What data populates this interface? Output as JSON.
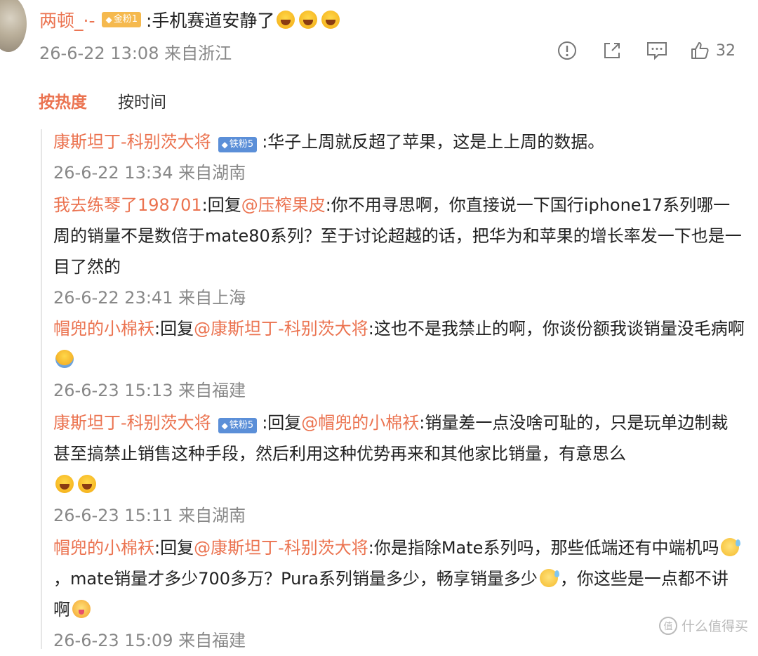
{
  "comment": {
    "username": "两顿_·-",
    "badge": "金粉1",
    "text": ":手机赛道安静了",
    "emojis": [
      "laugh",
      "laugh",
      "laugh"
    ],
    "time": "26-6-22 13:08",
    "location": "来自浙江",
    "likes": "32"
  },
  "sort": {
    "hot": "按热度",
    "time": "按时间"
  },
  "replies": [
    {
      "user": "康斯坦丁-科别茨大将",
      "badge": "铁粉5",
      "text": ":华子上周就反超了苹果，这是上上周的数据。",
      "time": "26-6-22 13:34",
      "location": "来自湖南"
    },
    {
      "user": "我去练琴了198701",
      "reply_label": ":回复",
      "mention": "@压榨果皮",
      "text": ":你不用寻思啊，你直接说一下国行iphone17系列哪一周的销量不是数倍于mate80系列？至于讨论超越的话，把华为和苹果的增长率发一下也是一目了然的",
      "time": "26-6-22 23:41",
      "location": "来自上海"
    },
    {
      "user": "帽兜的小棉袄",
      "reply_label": ":回复",
      "mention": "@康斯坦丁-科别茨大将",
      "text": ":这也不是我禁止的啊，你谈份额我谈销量没毛病啊",
      "time": "26-6-23 15:13",
      "location": "来自福建"
    },
    {
      "user": "康斯坦丁-科别茨大将",
      "badge": "铁粉5",
      "reply_label": ":回复",
      "mention": "@帽兜的小棉袄",
      "text": ":销量差一点没啥可耻的，只是玩单边制裁甚至搞禁止销售这种手段，然后利用这种优势再来和其他家比销量，有意思么",
      "time": "26-6-23 15:11",
      "location": "来自湖南"
    },
    {
      "user": "帽兜的小棉袄",
      "reply_label": ":回复",
      "mention": "@康斯坦丁-科别茨大将",
      "text_a": ":你是指除Mate系列吗，那些低端还有中端机吗",
      "text_b": "，mate销量才多少700多万？Pura系列销量多少，畅享销量多少",
      "text_c": "，你这些是一点都不讲啊",
      "time": "26-6-23 15:09",
      "location": "来自福建"
    }
  ],
  "watermark": "什么值得买",
  "colors": {
    "accent": "#eb7350",
    "meta": "#888888",
    "gold_badge": "#f5b94e",
    "iron_badge": "#5b8fd8"
  },
  "icons": [
    "report-icon",
    "share-icon",
    "comment-icon",
    "like-icon",
    "gem-icon",
    "watermark-logo-icon"
  ]
}
